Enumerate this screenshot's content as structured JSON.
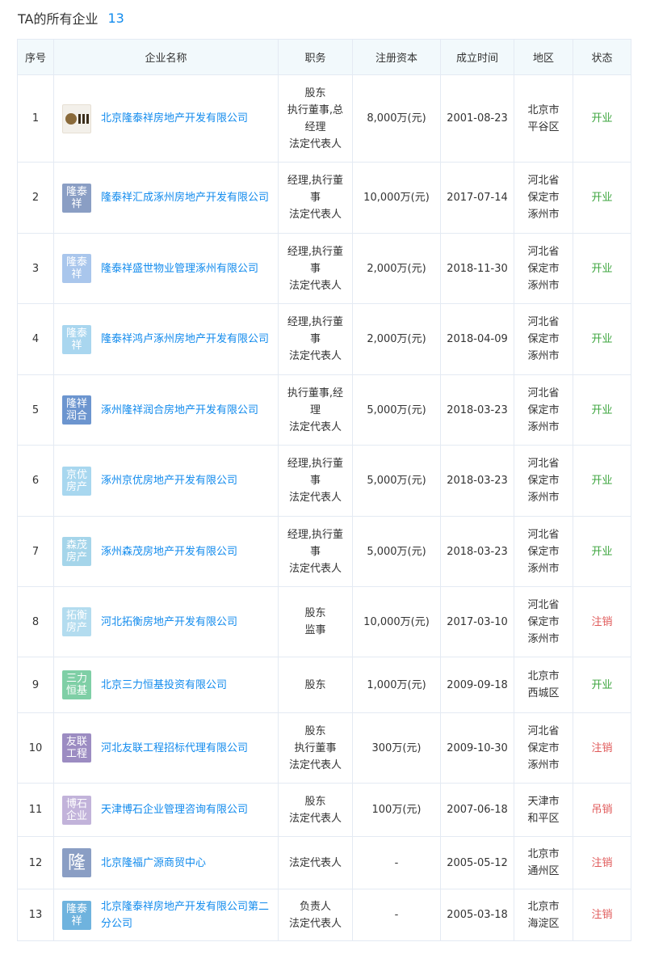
{
  "header": {
    "title": "TA的所有企业",
    "count": "13"
  },
  "columns": [
    "序号",
    "企业名称",
    "职务",
    "注册资本",
    "成立时间",
    "地区",
    "状态"
  ],
  "colors": {
    "link": "#128bed",
    "open": "#3ea63f",
    "closed": "#e05a5a"
  },
  "rows": [
    {
      "no": "1",
      "logo": {
        "type": "image-icon",
        "text": ""
      },
      "name": "北京隆泰祥房地产开发有限公司",
      "roles": [
        "股东",
        "执行董事,总",
        "经理",
        "法定代表人"
      ],
      "capital": "8,000万(元)",
      "date": "2001-08-23",
      "region": [
        "北京市",
        "平谷区"
      ],
      "status": "开业",
      "status_type": "open"
    },
    {
      "no": "2",
      "logo": {
        "text": "隆泰祥",
        "color": "#8a9ec4"
      },
      "name": "隆泰祥汇成涿州房地产开发有限公司",
      "roles": [
        "经理,执行董",
        "事",
        "法定代表人"
      ],
      "capital": "10,000万(元)",
      "date": "2017-07-14",
      "region": [
        "河北省",
        "保定市",
        "涿州市"
      ],
      "status": "开业",
      "status_type": "open"
    },
    {
      "no": "3",
      "logo": {
        "text": "隆泰祥",
        "color": "#a9c6ec"
      },
      "name": "隆泰祥盛世物业管理涿州有限公司",
      "roles": [
        "经理,执行董",
        "事",
        "法定代表人"
      ],
      "capital": "2,000万(元)",
      "date": "2018-11-30",
      "region": [
        "河北省",
        "保定市",
        "涿州市"
      ],
      "status": "开业",
      "status_type": "open"
    },
    {
      "no": "4",
      "logo": {
        "text": "隆泰祥",
        "color": "#a9d6ef"
      },
      "name": "隆泰祥鸿卢涿州房地产开发有限公司",
      "roles": [
        "经理,执行董",
        "事",
        "法定代表人"
      ],
      "capital": "2,000万(元)",
      "date": "2018-04-09",
      "region": [
        "河北省",
        "保定市",
        "涿州市"
      ],
      "status": "开业",
      "status_type": "open"
    },
    {
      "no": "5",
      "logo": {
        "text": "隆祥润合",
        "color": "#6c95cf"
      },
      "name": "涿州隆祥润合房地产开发有限公司",
      "roles": [
        "执行董事,经",
        "理",
        "法定代表人"
      ],
      "capital": "5,000万(元)",
      "date": "2018-03-23",
      "region": [
        "河北省",
        "保定市",
        "涿州市"
      ],
      "status": "开业",
      "status_type": "open"
    },
    {
      "no": "6",
      "logo": {
        "text": "京优房产",
        "color": "#a8d7ef"
      },
      "name": "涿州京优房地产开发有限公司",
      "roles": [
        "经理,执行董",
        "事",
        "法定代表人"
      ],
      "capital": "5,000万(元)",
      "date": "2018-03-23",
      "region": [
        "河北省",
        "保定市",
        "涿州市"
      ],
      "status": "开业",
      "status_type": "open"
    },
    {
      "no": "7",
      "logo": {
        "text": "森茂房产",
        "color": "#a5d5ea"
      },
      "name": "涿州森茂房地产开发有限公司",
      "roles": [
        "经理,执行董",
        "事",
        "法定代表人"
      ],
      "capital": "5,000万(元)",
      "date": "2018-03-23",
      "region": [
        "河北省",
        "保定市",
        "涿州市"
      ],
      "status": "开业",
      "status_type": "open"
    },
    {
      "no": "8",
      "logo": {
        "text": "拓衡房产",
        "color": "#b3dcef"
      },
      "name": "河北拓衡房地产开发有限公司",
      "roles": [
        "股东",
        "监事"
      ],
      "capital": "10,000万(元)",
      "date": "2017-03-10",
      "region": [
        "河北省",
        "保定市",
        "涿州市"
      ],
      "status": "注销",
      "status_type": "closed"
    },
    {
      "no": "9",
      "logo": {
        "text": "三力恒基",
        "color": "#7fcfa6"
      },
      "name": "北京三力恒基投资有限公司",
      "roles": [
        "股东"
      ],
      "capital": "1,000万(元)",
      "date": "2009-09-18",
      "region": [
        "北京市",
        "西城区"
      ],
      "status": "开业",
      "status_type": "open"
    },
    {
      "no": "10",
      "logo": {
        "text": "友联工程",
        "color": "#9c8cc2"
      },
      "name": "河北友联工程招标代理有限公司",
      "roles": [
        "股东",
        "执行董事",
        "法定代表人"
      ],
      "capital": "300万(元)",
      "date": "2009-10-30",
      "region": [
        "河北省",
        "保定市",
        "涿州市"
      ],
      "status": "注销",
      "status_type": "closed"
    },
    {
      "no": "11",
      "logo": {
        "text": "博石企业",
        "color": "#c2b3da"
      },
      "name": "天津博石企业管理咨询有限公司",
      "roles": [
        "股东",
        "法定代表人"
      ],
      "capital": "100万(元)",
      "date": "2007-06-18",
      "region": [
        "天津市",
        "和平区"
      ],
      "status": "吊销",
      "status_type": "revoked"
    },
    {
      "no": "12",
      "logo": {
        "text": "隆",
        "color": "#8a9ec4",
        "big": true
      },
      "name": "北京隆福广源商贸中心",
      "roles": [
        "法定代表人"
      ],
      "capital": "-",
      "date": "2005-05-12",
      "region": [
        "北京市",
        "通州区"
      ],
      "status": "注销",
      "status_type": "closed"
    },
    {
      "no": "13",
      "logo": {
        "text": "隆泰祥",
        "color": "#6fb3de"
      },
      "name": "北京隆泰祥房地产开发有限公司第二分公司",
      "roles": [
        "负责人",
        "法定代表人"
      ],
      "capital": "-",
      "date": "2005-03-18",
      "region": [
        "北京市",
        "海淀区"
      ],
      "status": "注销",
      "status_type": "closed"
    }
  ]
}
